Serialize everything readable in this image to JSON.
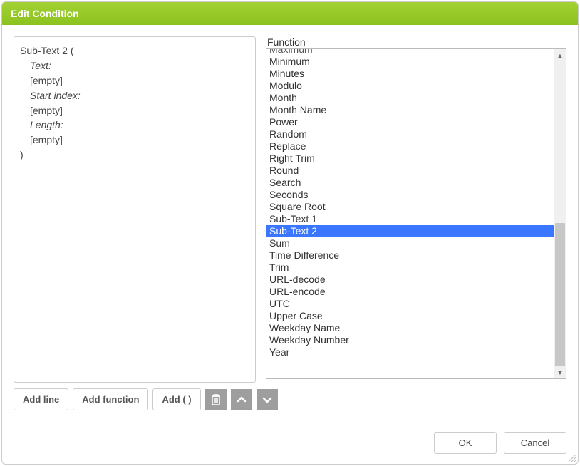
{
  "dialog": {
    "title": "Edit Condition"
  },
  "expression": {
    "func_name": "Sub-Text 2",
    "open": "(",
    "close": ")",
    "params": [
      {
        "label": "Text:",
        "value": "[empty]"
      },
      {
        "label": "Start index:",
        "value": "[empty]"
      },
      {
        "label": "Length:",
        "value": "[empty]"
      }
    ]
  },
  "function_picker": {
    "label": "Function",
    "selected": "Sub-Text 2",
    "scroll_top_cut": "Maximum",
    "items": [
      "Minimum",
      "Minutes",
      "Modulo",
      "Month",
      "Month Name",
      "Power",
      "Random",
      "Replace",
      "Right Trim",
      "Round",
      "Search",
      "Seconds",
      "Square Root",
      "Sub-Text 1",
      "Sub-Text 2",
      "Sum",
      "Time Difference",
      "Trim",
      "URL-decode",
      "URL-encode",
      "UTC",
      "Upper Case",
      "Weekday Name",
      "Weekday Number",
      "Year"
    ]
  },
  "toolbar": {
    "add_line": "Add line",
    "add_function": "Add function",
    "add_parens": "Add ( )"
  },
  "footer": {
    "ok": "OK",
    "cancel": "Cancel"
  }
}
